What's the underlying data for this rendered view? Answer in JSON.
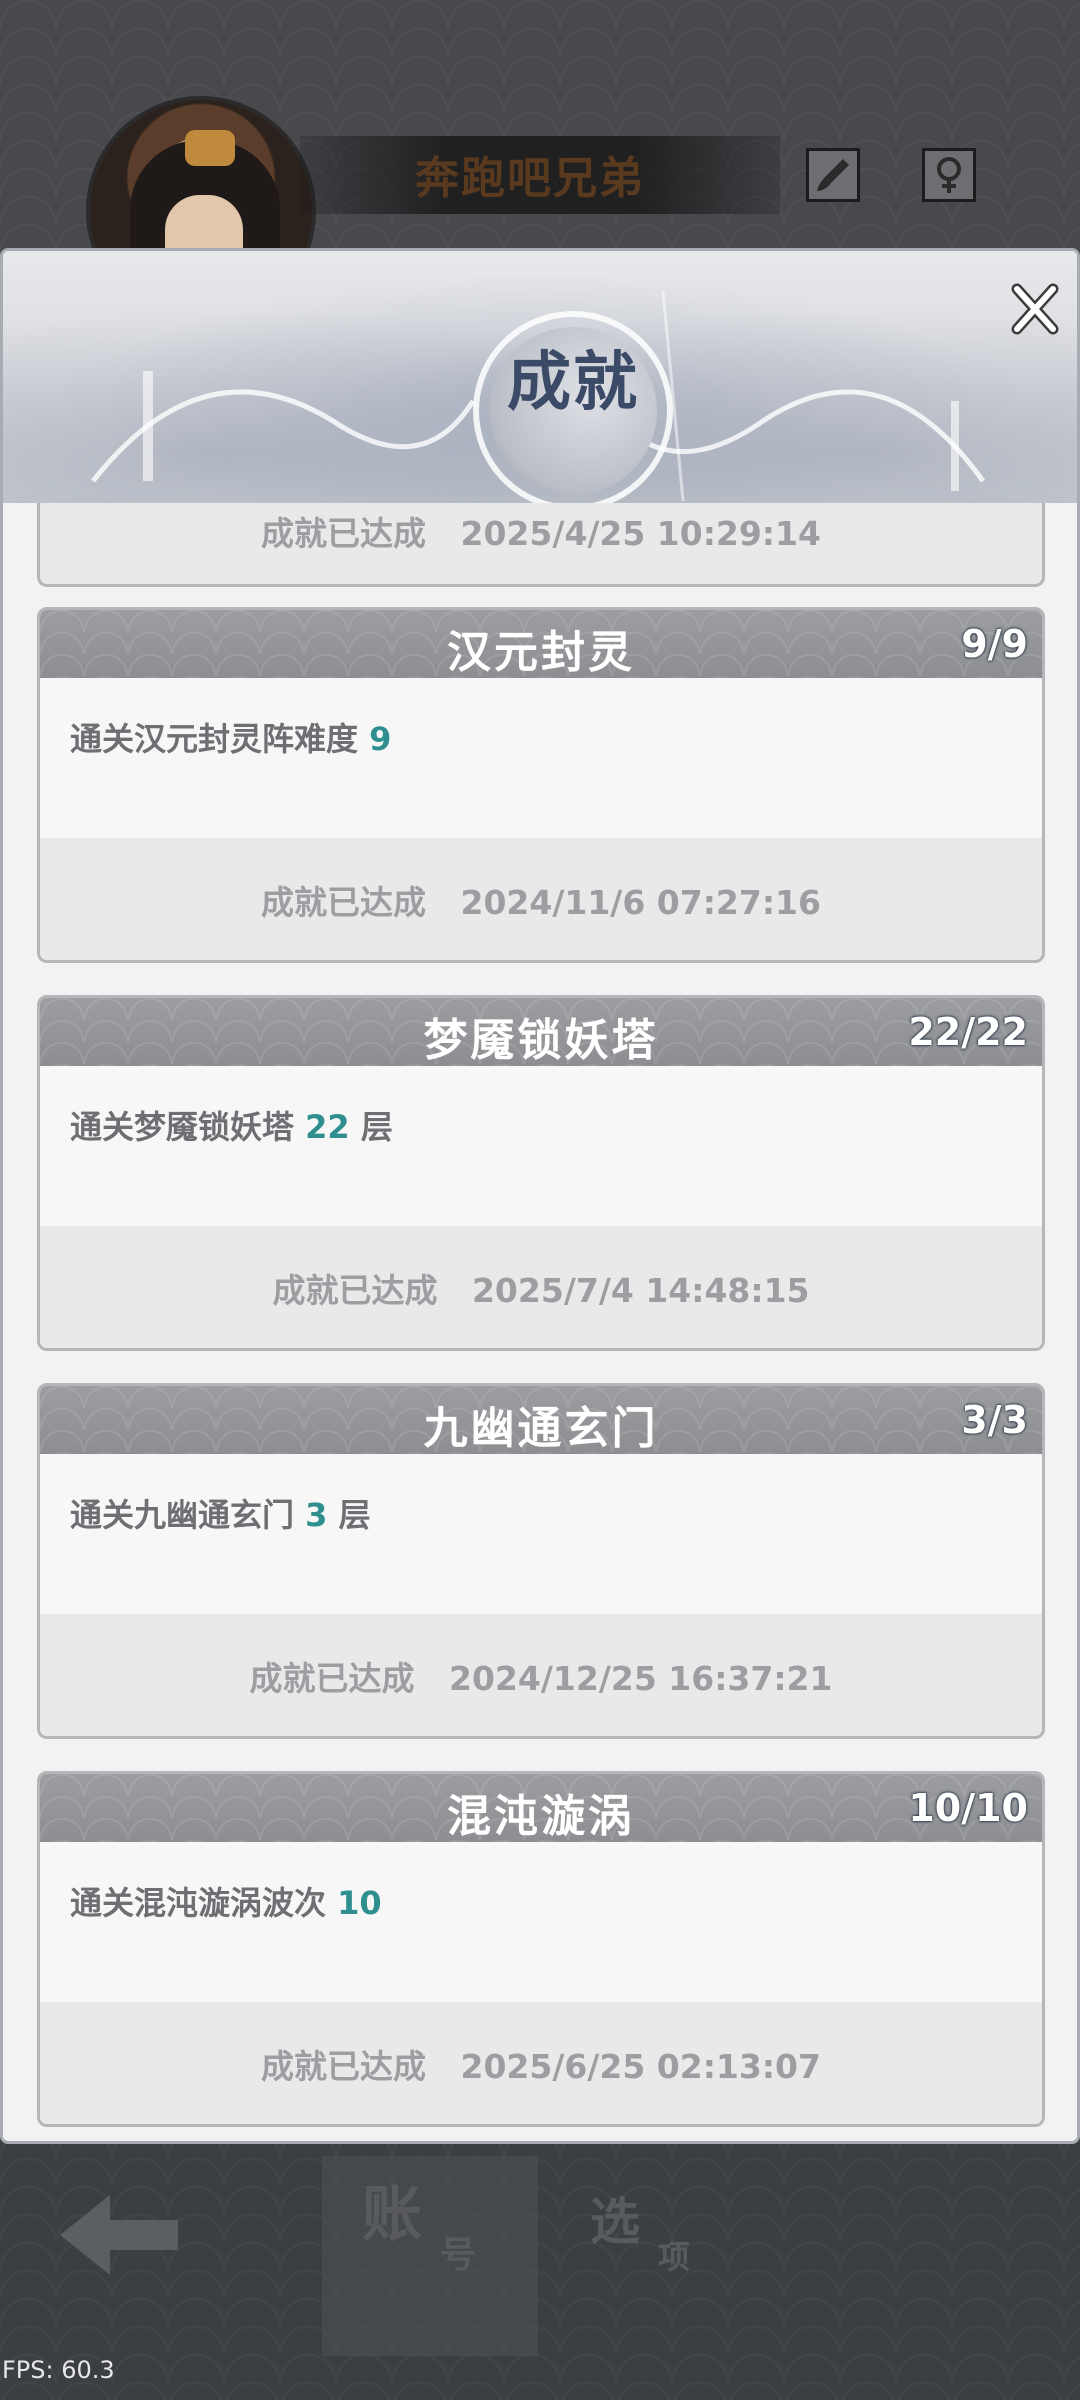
{
  "background": {
    "player_name": "奔跑吧兄弟",
    "icons": [
      "brush-icon",
      "gender-icon"
    ],
    "back_icon": "back-arrow-icon",
    "tabs": [
      {
        "big": "账",
        "small": "号"
      },
      {
        "big": "选",
        "small": "项"
      }
    ]
  },
  "modal": {
    "title": "成就",
    "close_icon": "close-icon"
  },
  "partial_card": {
    "status": "成就已达成",
    "time": "2025/4/25 10:29:14"
  },
  "achievements": [
    {
      "title": "汉元封灵",
      "progress": "9/9",
      "desc_prefix": "通关汉元封灵阵难度 ",
      "desc_num": "9",
      "desc_suffix": "",
      "status": "成就已达成",
      "time": "2024/11/6 07:27:16"
    },
    {
      "title": "梦魇锁妖塔",
      "progress": "22/22",
      "desc_prefix": "通关梦魇锁妖塔 ",
      "desc_num": "22",
      "desc_suffix": " 层",
      "status": "成就已达成",
      "time": "2025/7/4 14:48:15"
    },
    {
      "title": "九幽通玄门",
      "progress": "3/3",
      "desc_prefix": "通关九幽通玄门 ",
      "desc_num": "3",
      "desc_suffix": " 层",
      "status": "成就已达成",
      "time": "2024/12/25 16:37:21"
    },
    {
      "title": "混沌漩涡",
      "progress": "10/10",
      "desc_prefix": "通关混沌漩涡波次 ",
      "desc_num": "10",
      "desc_suffix": "",
      "status": "成就已达成",
      "time": "2025/6/25 02:13:07"
    }
  ],
  "fps": "FPS: 60.3",
  "colors": {
    "accent_number": "#2f8f8f",
    "title_ink": "#3b4a66",
    "card_header": "#8d8e92"
  }
}
